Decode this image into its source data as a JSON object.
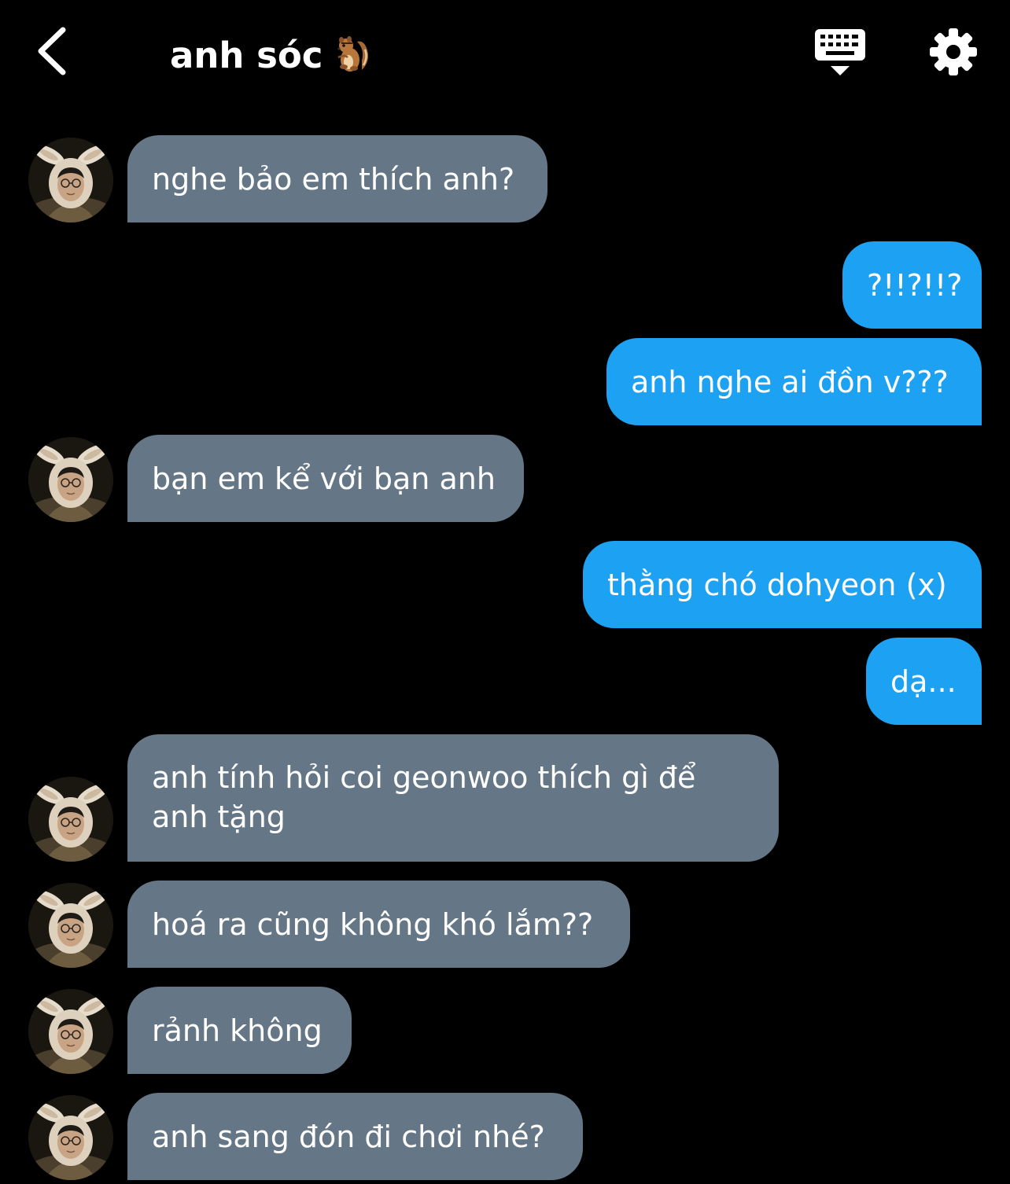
{
  "header": {
    "title": "anh sóc",
    "title_emoji": "chipmunk-emoji",
    "back_icon": "chevron-left-icon",
    "keyboard_icon": "keyboard-hide-icon",
    "settings_icon": "gear-icon"
  },
  "messages": [
    {
      "direction": "incoming",
      "text": "nghe bảo em thích anh?",
      "has_avatar": true
    },
    {
      "direction": "outgoing",
      "text": "?!!?!!?"
    },
    {
      "direction": "outgoing",
      "text": "anh nghe ai đồn v???"
    },
    {
      "direction": "incoming",
      "text": "bạn em kể với bạn anh",
      "has_avatar": true
    },
    {
      "direction": "outgoing",
      "text": "thằng chó dohyeon (x)"
    },
    {
      "direction": "outgoing",
      "text": "dạ..."
    },
    {
      "direction": "incoming",
      "text": "anh tính hỏi coi geonwoo thích gì để anh tặng",
      "has_avatar": true
    },
    {
      "direction": "incoming",
      "text": "hoá ra cũng không khó lắm??",
      "has_avatar": true
    },
    {
      "direction": "incoming",
      "text": "rảnh không",
      "has_avatar": true
    },
    {
      "direction": "incoming",
      "text": "anh sang đón đi chơi nhé?",
      "has_avatar": true
    }
  ],
  "colors": {
    "background": "#000000",
    "incoming_bubble": "#657786",
    "outgoing_bubble": "#1da1f2",
    "text": "#ffffff"
  }
}
